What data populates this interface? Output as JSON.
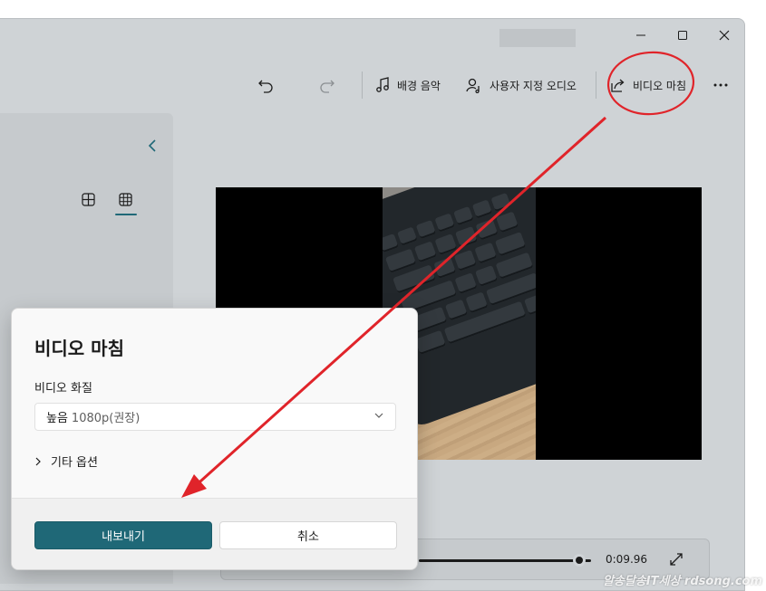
{
  "toolbar": {
    "background_music": "배경 음악",
    "custom_audio": "사용자 지정 오디오",
    "finish_video": "비디오 마침"
  },
  "dialog": {
    "title": "비디오 마침",
    "quality_label": "비디오 화질",
    "quality_value": "높음",
    "quality_detail": "1080p(권장)",
    "more_options": "기타 옵션",
    "export_button": "내보내기",
    "cancel_button": "취소"
  },
  "timeline": {
    "time": "0:09.96",
    "progress": 0.93
  },
  "watermark": "알송달송IT세상 rdsong.com",
  "colors": {
    "accent": "#1f6877",
    "annotation": "#e0242a"
  }
}
